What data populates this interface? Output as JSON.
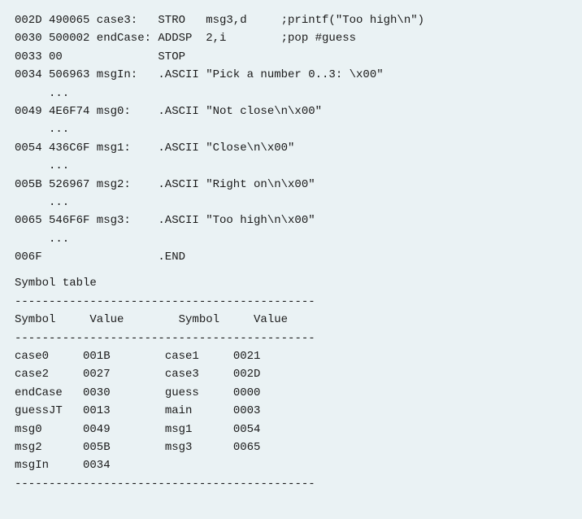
{
  "listing": [
    {
      "addr": "002D",
      "obj": "490065",
      "label": "case3:",
      "mnem": "STRO",
      "oper": "msg3,d",
      "cmt": ";printf(\"Too high\\n\")"
    },
    {
      "addr": "0030",
      "obj": "500002",
      "label": "endCase:",
      "mnem": "ADDSP",
      "oper": "2,i",
      "cmt": ";pop #guess"
    },
    {
      "addr": "0033",
      "obj": "00",
      "label": "",
      "mnem": "STOP",
      "oper": "",
      "cmt": ""
    },
    {
      "addr": "0034",
      "obj": "506963",
      "label": "msgIn:",
      "mnem": ".ASCII",
      "oper": "\"Pick a number 0..3: \\x00\"",
      "cmt": ""
    },
    {
      "addr": "",
      "obj": "...",
      "label": "",
      "mnem": "",
      "oper": "",
      "cmt": ""
    },
    {
      "addr": "0049",
      "obj": "4E6F74",
      "label": "msg0:",
      "mnem": ".ASCII",
      "oper": "\"Not close\\n\\x00\"",
      "cmt": ""
    },
    {
      "addr": "",
      "obj": "...",
      "label": "",
      "mnem": "",
      "oper": "",
      "cmt": ""
    },
    {
      "addr": "0054",
      "obj": "436C6F",
      "label": "msg1:",
      "mnem": ".ASCII",
      "oper": "\"Close\\n\\x00\"",
      "cmt": ""
    },
    {
      "addr": "",
      "obj": "...",
      "label": "",
      "mnem": "",
      "oper": "",
      "cmt": ""
    },
    {
      "addr": "005B",
      "obj": "526967",
      "label": "msg2:",
      "mnem": ".ASCII",
      "oper": "\"Right on\\n\\x00\"",
      "cmt": ""
    },
    {
      "addr": "",
      "obj": "...",
      "label": "",
      "mnem": "",
      "oper": "",
      "cmt": ""
    },
    {
      "addr": "0065",
      "obj": "546F6F",
      "label": "msg3:",
      "mnem": ".ASCII",
      "oper": "\"Too high\\n\\x00\"",
      "cmt": ""
    },
    {
      "addr": "",
      "obj": "...",
      "label": "",
      "mnem": "",
      "oper": "",
      "cmt": ""
    },
    {
      "addr": "006F",
      "obj": "",
      "label": "",
      "mnem": ".END",
      "oper": "",
      "cmt": ""
    }
  ],
  "symbol_table": {
    "title": "Symbol table",
    "dashes": "--------------------------------------------",
    "headers": {
      "c1": "Symbol",
      "c2": "Value",
      "c3": "Symbol",
      "c4": "Value"
    },
    "rows": [
      {
        "c1": "case0",
        "c2": "001B",
        "c3": "case1",
        "c4": "0021"
      },
      {
        "c1": "case2",
        "c2": "0027",
        "c3": "case3",
        "c4": "002D"
      },
      {
        "c1": "endCase",
        "c2": "0030",
        "c3": "guess",
        "c4": "0000"
      },
      {
        "c1": "guessJT",
        "c2": "0013",
        "c3": "main",
        "c4": "0003"
      },
      {
        "c1": "msg0",
        "c2": "0049",
        "c3": "msg1",
        "c4": "0054"
      },
      {
        "c1": "msg2",
        "c2": "005B",
        "c3": "msg3",
        "c4": "0065"
      },
      {
        "c1": "msgIn",
        "c2": "0034",
        "c3": "",
        "c4": ""
      }
    ]
  }
}
